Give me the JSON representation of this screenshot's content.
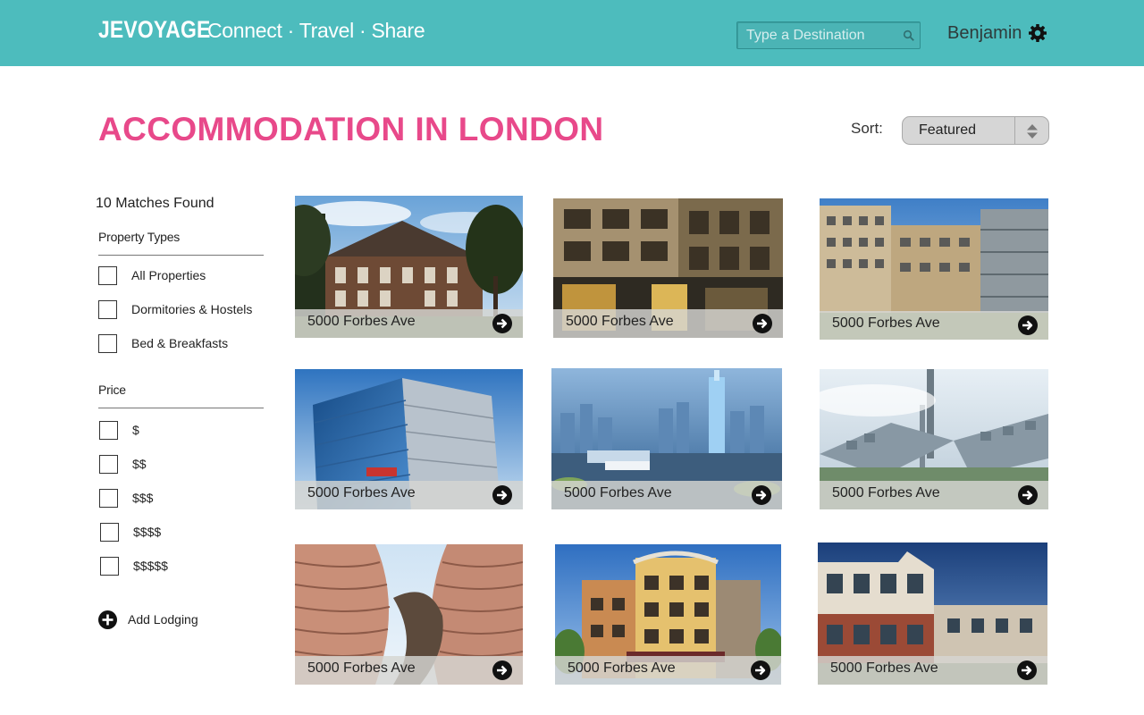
{
  "header": {
    "logo": "JEVOYAGE",
    "tagline": "Connect · Travel · Share",
    "search_placeholder": "Type a Destination",
    "username": "Benjamin",
    "icons": {
      "search": "search-icon",
      "settings": "gear-icon"
    },
    "colors": {
      "bar": "#4dbcbd",
      "text": "#ffffff"
    }
  },
  "page": {
    "title": "ACCOMMODATION IN LONDON",
    "title_color": "#e8498a",
    "sort_label": "Sort:",
    "sort_value": "Featured"
  },
  "sidebar": {
    "matches": "10 Matches Found",
    "property_types": {
      "title": "Property Types",
      "options": [
        {
          "label": "All Properties",
          "checked": false
        },
        {
          "label": "Dormitories & Hostels",
          "checked": false
        },
        {
          "label": "Bed & Breakfasts",
          "checked": false
        }
      ]
    },
    "price": {
      "title": "Price",
      "options": [
        {
          "label": "$",
          "checked": false
        },
        {
          "label": "$$",
          "checked": false
        },
        {
          "label": "$$$",
          "checked": false
        },
        {
          "label": "$$$$",
          "checked": false
        },
        {
          "label": "$$$$$",
          "checked": false
        }
      ]
    },
    "add_lodging": "Add Lodging"
  },
  "listings": [
    {
      "address": "5000 Forbes Ave",
      "photo": "brick-manor-house"
    },
    {
      "address": "5000 Forbes Ave",
      "photo": "stone-hotel-facade"
    },
    {
      "address": "5000 Forbes Ave",
      "photo": "modern-apartment-block"
    },
    {
      "address": "5000 Forbes Ave",
      "photo": "glass-office-tower"
    },
    {
      "address": "5000 Forbes Ave",
      "photo": "aerial-city-skyline"
    },
    {
      "address": "5000 Forbes Ave",
      "photo": "misty-aerial-city"
    },
    {
      "address": "5000 Forbes Ave",
      "photo": "curved-residential-tower"
    },
    {
      "address": "5000 Forbes Ave",
      "photo": "corner-apartment-building"
    },
    {
      "address": "5000 Forbes Ave",
      "photo": "brick-condo-complex"
    }
  ]
}
